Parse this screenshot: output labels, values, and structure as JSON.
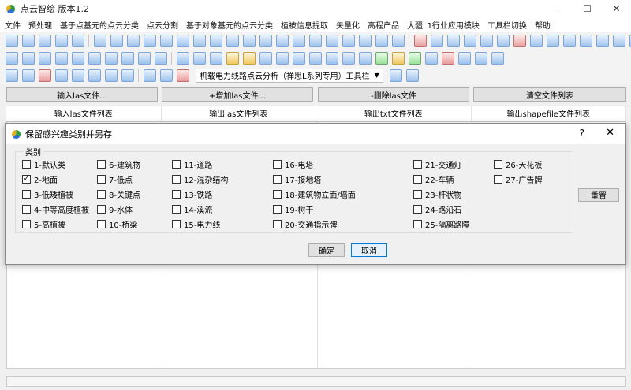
{
  "window": {
    "title": "点云智绘 版本1.2",
    "min": "–",
    "max": "☐",
    "close": "✕"
  },
  "menu": [
    "文件",
    "预处理",
    "基于点基元的点云分类",
    "点云分割",
    "基于对象基元的点云分类",
    "植被信息提取",
    "矢量化",
    "高程产品",
    "大疆L1行业应用模块",
    "工具栏切换",
    "帮助"
  ],
  "toolbar": {
    "combo_label": "机载电力线路点云分析（禅思L系列专用）工具栏",
    "combo_arrow": "▼"
  },
  "buttons": {
    "input_las": "输入las文件...",
    "add_las": "+增加las文件...",
    "delete_las": "-删除las文件",
    "clear_list": "清空文件列表"
  },
  "columns": [
    "输入las文件列表",
    "输出las文件列表",
    "输出txt文件列表",
    "输出shapefile文件列表"
  ],
  "dialog": {
    "title": "保留感兴趣类别并另存",
    "help": "?",
    "close": "✕",
    "group_label": "类别",
    "categories": [
      {
        "label": "1-默认类",
        "checked": false
      },
      {
        "label": "2-地面",
        "checked": true
      },
      {
        "label": "3-低矮植被",
        "checked": false
      },
      {
        "label": "4-中等高度植被",
        "checked": false
      },
      {
        "label": "5-高植被",
        "checked": false
      },
      {
        "label": "6-建筑物",
        "checked": false
      },
      {
        "label": "7-低点",
        "checked": false
      },
      {
        "label": "8-关键点",
        "checked": false
      },
      {
        "label": "9-水体",
        "checked": false
      },
      {
        "label": "10-桥梁",
        "checked": false
      },
      {
        "label": "11-道路",
        "checked": false
      },
      {
        "label": "12-混杂结构",
        "checked": false
      },
      {
        "label": "13-铁路",
        "checked": false
      },
      {
        "label": "14-溪流",
        "checked": false
      },
      {
        "label": "15-电力线",
        "checked": false
      },
      {
        "label": "16-电塔",
        "checked": false
      },
      {
        "label": "17-接地塔",
        "checked": false
      },
      {
        "label": "18-建筑物立面/墙面",
        "checked": false
      },
      {
        "label": "19-树干",
        "checked": false
      },
      {
        "label": "20-交通指示牌",
        "checked": false
      },
      {
        "label": "21-交通灯",
        "checked": false
      },
      {
        "label": "22-车辆",
        "checked": false
      },
      {
        "label": "23-杆状物",
        "checked": false
      },
      {
        "label": "24-路沿石",
        "checked": false
      },
      {
        "label": "25-隔离路障",
        "checked": false
      },
      {
        "label": "26-天花板",
        "checked": false
      },
      {
        "label": "27-广告牌",
        "checked": false
      }
    ],
    "reset": "重置",
    "ok": "确定",
    "cancel": "取消"
  }
}
